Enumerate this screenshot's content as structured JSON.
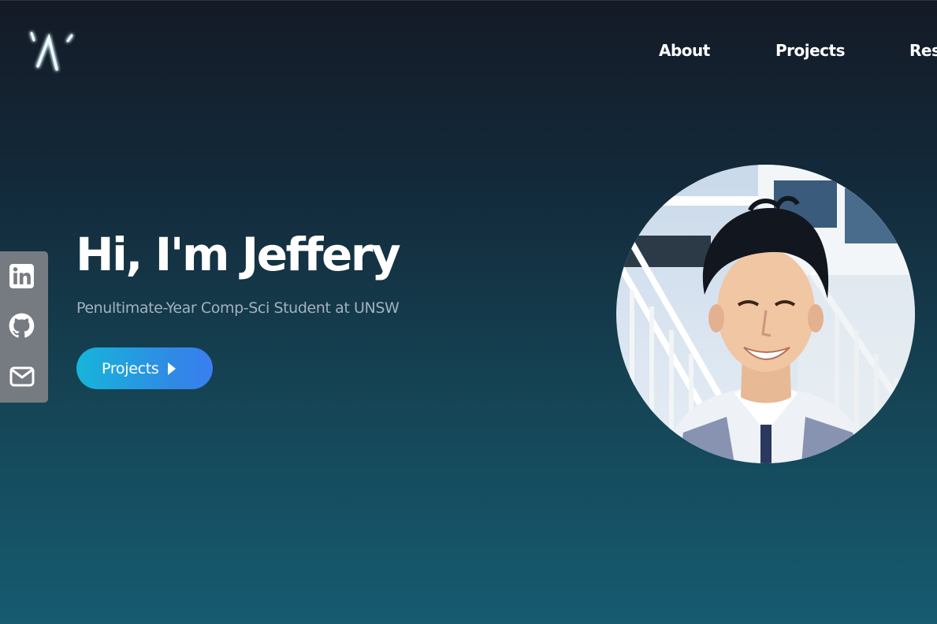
{
  "header": {
    "logo_icon": "glowing-a-logo-icon",
    "nav": [
      {
        "label": "About"
      },
      {
        "label": "Projects"
      },
      {
        "label": "Resume"
      }
    ]
  },
  "social": {
    "items": [
      {
        "icon": "linkedin-icon"
      },
      {
        "icon": "github-icon"
      },
      {
        "icon": "mail-icon"
      }
    ]
  },
  "hero": {
    "title": "Hi, I'm Jeffery",
    "subtitle": "Penultimate-Year Comp-Sci Student at UNSW",
    "cta_label": "Projects"
  },
  "colors": {
    "accent_start": "#16b5da",
    "accent_end": "#3a7ef0",
    "bg_top": "#141a26",
    "bg_bottom": "#165b71",
    "social_bar": "#767b82"
  }
}
